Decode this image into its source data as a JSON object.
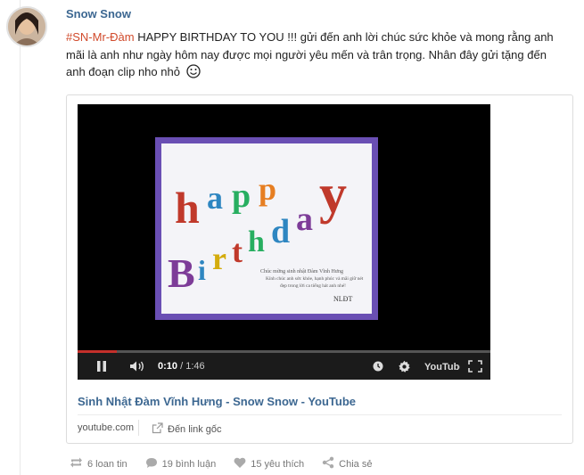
{
  "post": {
    "author": "Snow Snow",
    "hashtag": "#SN-Mr-Đàm",
    "body": "HAPPY BIRTHDAY TO YOU !!! gửi đến anh lời chúc sức khỏe và mong rằng anh mãi là anh như ngày hôm nay được mọi người yêu mến và trân trọng. Nhân đây gửi tặng đến anh đoạn clip nho nhỏ"
  },
  "video": {
    "current_time": "0:10",
    "duration": "/ 1:46",
    "progress": 0.094,
    "youtube_logo": "YouTube",
    "thumbnail": {
      "letters_happy": [
        "h",
        "a",
        "p",
        "p",
        "y"
      ],
      "letters_birthday": [
        "B",
        "i",
        "r",
        "t",
        "h",
        "d",
        "a",
        "y"
      ],
      "caption_lines": [
        "Chúc mừng sinh nhật Đàm Vĩnh Hưng",
        "Kính chúc anh sức khỏe, hạnh phúc và mãi giữ nét",
        "đẹp trong lời ca tiếng hát anh nhé!"
      ],
      "signature": "NLĐT"
    }
  },
  "card": {
    "title": "Sinh Nhật Đàm Vĩnh Hưng - Snow Snow - YouTube",
    "source": "youtube.com",
    "link_label": "Đến link gốc"
  },
  "actions": {
    "shares": "6 loan tin",
    "comments": "19 bình luận",
    "likes": "15 yêu thích",
    "share": "Chia sẻ"
  },
  "icons": [
    "avatar",
    "smile-icon",
    "pause-icon",
    "volume-icon",
    "clock-icon",
    "gear-icon",
    "youtube-logo",
    "fullscreen-icon",
    "external-link-icon",
    "repost-icon",
    "comment-icon",
    "heart-icon",
    "share-icon"
  ],
  "colors": {
    "link_blue": "#3c6791",
    "hashtag": "#d14a2b",
    "progress_red": "#c4302b",
    "frame_purple": "#6a4fb4"
  }
}
